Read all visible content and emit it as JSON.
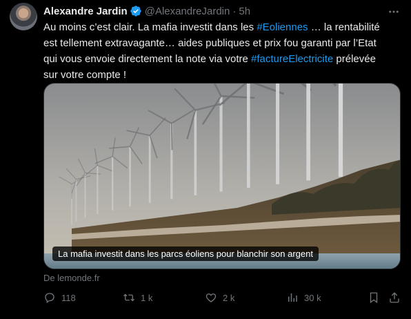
{
  "author": {
    "name": "Alexandre Jardin",
    "handle": "@AlexandreJardin",
    "separator": "·",
    "time": "5h"
  },
  "tweet": {
    "line1_a": "Au moins c’est clair. La mafia investit dans les ",
    "line1_tag": "#Eoliennes",
    "line1_b": " … la rentabilité",
    "line2": "est tellement extravagante… aides publiques et prix fou garanti par l’Etat",
    "line3_a": "qui vous envoie directement la note via votre ",
    "line3_tag": "#factureElectricite",
    "line3_b": " prélevée",
    "line4": "sur votre compte !"
  },
  "card": {
    "caption": "La mafia investit dans les parcs éoliens pour blanchir son argent",
    "source": "De lemonde.fr"
  },
  "actions": {
    "replies": "118",
    "reposts": "1 k",
    "likes": "2 k",
    "views": "30 k"
  },
  "colors": {
    "background": "#000000",
    "text": "#e7e9ea",
    "muted": "#71767b",
    "link": "#1d9bf0"
  },
  "icons": [
    "verified-badge-icon",
    "more-icon",
    "reply-icon",
    "repost-icon",
    "like-icon",
    "views-icon",
    "bookmark-icon",
    "share-icon"
  ]
}
